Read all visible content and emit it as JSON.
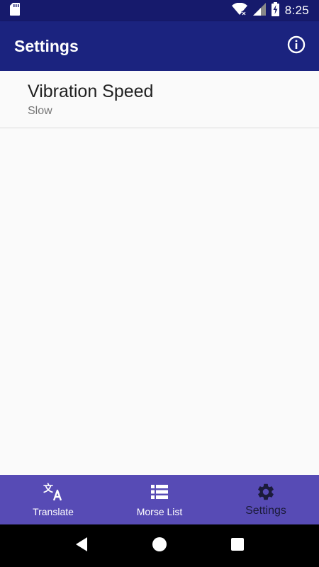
{
  "status_bar": {
    "time": "8:25",
    "icons": [
      "sd-card-icon",
      "wifi-icon",
      "signal-icon",
      "battery-charging-icon"
    ]
  },
  "app_bar": {
    "title": "Settings",
    "info_icon": "info-icon"
  },
  "preferences": [
    {
      "title": "Vibration Speed",
      "summary": "Slow"
    }
  ],
  "bottom_nav": {
    "items": [
      {
        "label": "Translate",
        "icon": "translate-icon",
        "active": false
      },
      {
        "label": "Morse List",
        "icon": "list-icon",
        "active": false
      },
      {
        "label": "Settings",
        "icon": "gear-icon",
        "active": true
      }
    ]
  },
  "system_nav": {
    "buttons": [
      "back-icon",
      "home-icon",
      "recents-icon"
    ]
  },
  "colors": {
    "status_bar": "#161a6c",
    "app_bar": "#1b237f",
    "bottom_nav": "#574bb5",
    "background": "#fafafa"
  }
}
